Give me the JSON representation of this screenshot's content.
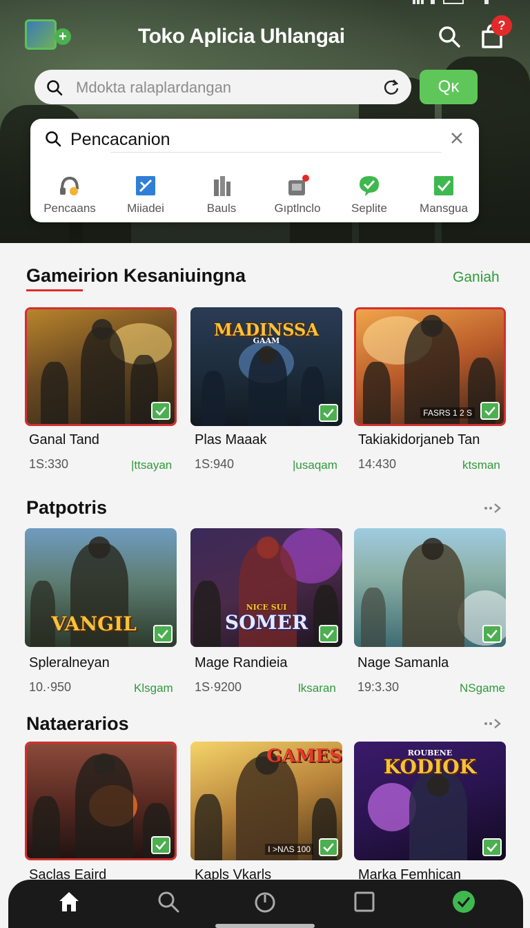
{
  "header": {
    "title": "Toko Aplicia Uhlangai",
    "search_placeholder": "Mdokta ralaplardangan",
    "ok_label": "Qκ",
    "notification_badge": "?"
  },
  "search_panel": {
    "query": "Pencacanion",
    "categories": [
      {
        "label": "Pencaans",
        "icon": "headset-icon"
      },
      {
        "label": "Miiadei",
        "icon": "sword-icon"
      },
      {
        "label": "Bauls",
        "icon": "tower-icon"
      },
      {
        "label": "Gıptlnclo",
        "icon": "puzzle-icon"
      },
      {
        "label": "Seplite",
        "icon": "chat-check-icon"
      },
      {
        "label": "Mansgua",
        "icon": "check-box-icon"
      }
    ]
  },
  "sections": [
    {
      "title": "Gameirion Kesaniuingna",
      "link": "Ganiah",
      "games": [
        {
          "name": "Ganal Tand",
          "count": "1S:330",
          "tag": "|ttsayan"
        },
        {
          "name": "Plas Maaak",
          "count": "1S:940",
          "tag": "|usaqam",
          "banner": "MADINSSA",
          "banner_sub": "GAAM"
        },
        {
          "name": "Takiakidorjaneb Tan",
          "count": "14:430",
          "tag": "ktsman",
          "corner": "FASRS 1 2 S"
        }
      ]
    },
    {
      "title": "Patpotris",
      "games": [
        {
          "name": "Spleralneyan",
          "count": "10.·950",
          "tag": "Klsgam",
          "banner": "VANGIL"
        },
        {
          "name": "Mage Randieia",
          "count": "1S·9200",
          "tag": "lksaran",
          "banner": "SOMER",
          "banner_sub": "NICE SUI"
        },
        {
          "name": "Nage Samanla",
          "count": "19:3.30",
          "tag": "NSgame"
        }
      ]
    },
    {
      "title": "Nataerarios",
      "games": [
        {
          "name": "Saclas Eaird",
          "count": "",
          "tag": ""
        },
        {
          "name": "Kapls Vkarls",
          "count": "",
          "tag": "",
          "banner": "GAMES",
          "corner": "I >NΛS 100"
        },
        {
          "name": "Marka Femhican",
          "count": "",
          "tag": "",
          "banner": "KODIOK",
          "banner_sub": "ROUBENE"
        }
      ]
    }
  ],
  "bottom_nav": [
    "home-icon",
    "search-icon",
    "power-icon",
    "square-icon",
    "check-circle-icon"
  ],
  "colors": {
    "accent": "#5fc75a",
    "link": "#2f9a3a",
    "badge": "#e22a2a",
    "nav_bg": "#1a1a1a"
  }
}
